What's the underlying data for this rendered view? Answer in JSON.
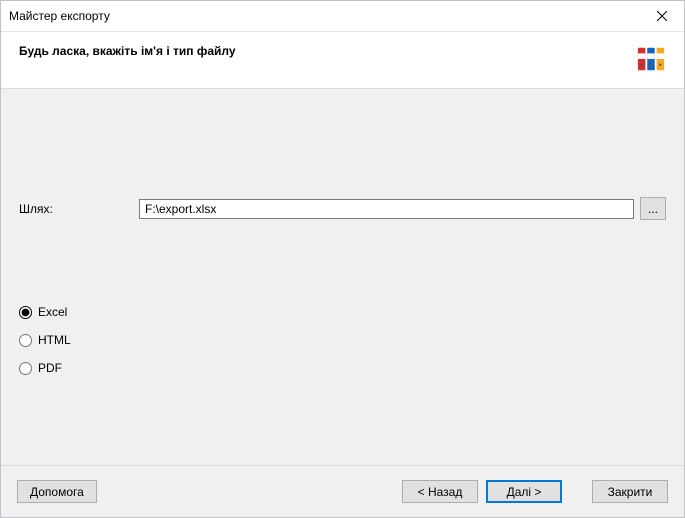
{
  "window": {
    "title": "Майстер експорту"
  },
  "header": {
    "heading": "Будь ласка, вкажіть ім'я і тип файлу"
  },
  "path": {
    "label": "Шлях:",
    "value": "F:\\export.xlsx",
    "browse_label": "..."
  },
  "formats": {
    "options": [
      {
        "label": "Excel",
        "selected": true
      },
      {
        "label": "HTML",
        "selected": false
      },
      {
        "label": "PDF",
        "selected": false
      }
    ]
  },
  "footer": {
    "help": "Допомога",
    "back": "< Назад",
    "next": "Далі >",
    "close": "Закрити"
  }
}
